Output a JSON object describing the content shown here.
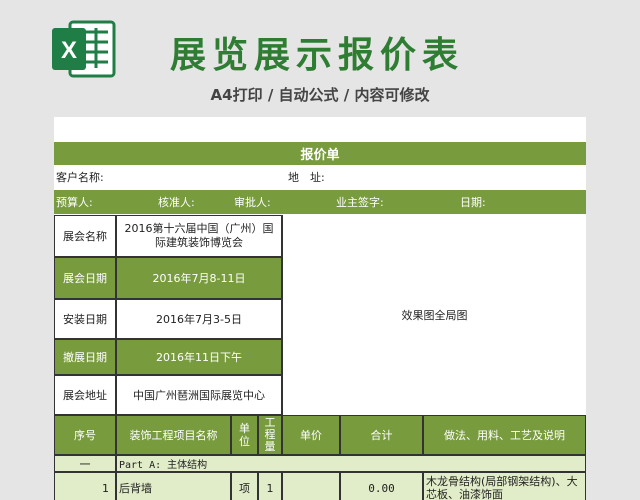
{
  "header": {
    "title": "展览展示报价表",
    "subtitle": "A4打印 / 自动公式 / 内容可修改",
    "logo_icon": "excel-icon"
  },
  "sheet": {
    "title": "报价单",
    "client_label": "客户名称:",
    "address_label": "地　址:",
    "budget_label": "预算人:",
    "verifier_label": "核准人:",
    "approver_label": "审批人:",
    "owner_sign_label": "业主签字:",
    "date_label": "日期:",
    "info": [
      {
        "label": "展会名称",
        "value": "2016第十六届中国（广州）国际建筑装饰博览会"
      },
      {
        "label": "展会日期",
        "value": "2016年7月8-11日"
      },
      {
        "label": "安装日期",
        "value": "2016年7月3-5日"
      },
      {
        "label": "撤展日期",
        "value": "2016年11日下午"
      },
      {
        "label": "展会地址",
        "value": "中国广州琶洲国际展览中心"
      }
    ],
    "image_placeholder": "效果图全局图",
    "columns": [
      "序号",
      "装饰工程项目名称",
      "单位",
      "工程量",
      "单价",
      "合计",
      "做法、用料、工艺及说明"
    ],
    "section": {
      "number": "一",
      "name": "Part A: 主体结构"
    },
    "rows": [
      {
        "no": "1",
        "name": "后背墙",
        "unit": "项",
        "qty": "1",
        "price": "",
        "total": "0.00",
        "note": "木龙骨结构(局部钢架结构)、大芯板、油漆饰面"
      }
    ]
  },
  "colors": {
    "green": "#789b3e",
    "light_green": "#e1ecc8",
    "title_green": "#2e7d32"
  }
}
